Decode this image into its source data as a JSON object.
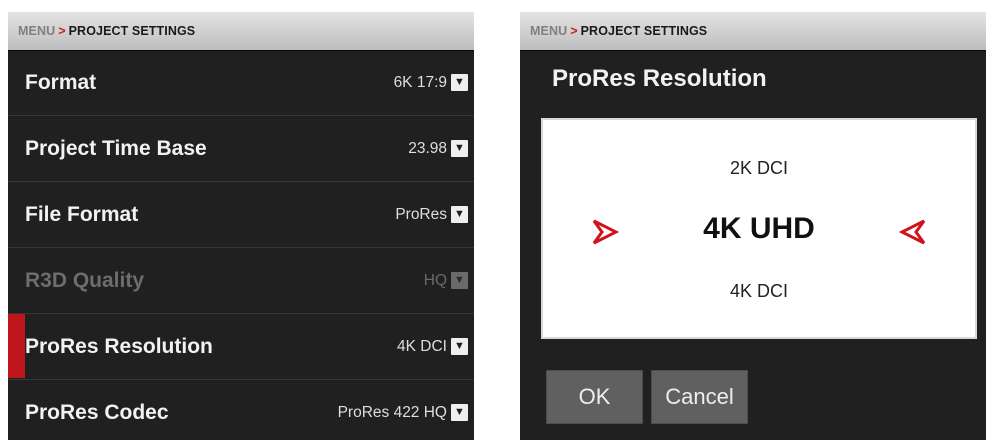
{
  "left": {
    "breadcrumb": {
      "menu": "MENU",
      "separator": ">",
      "page": "PROJECT SETTINGS"
    },
    "rows": [
      {
        "label": "Format",
        "value": "6K 17:9"
      },
      {
        "label": "Project Time Base",
        "value": "23.98"
      },
      {
        "label": "File Format",
        "value": "ProRes"
      },
      {
        "label": "R3D Quality",
        "value": "HQ",
        "disabled": true
      },
      {
        "label": "ProRes Resolution",
        "value": "4K DCI",
        "selected": true
      },
      {
        "label": "ProRes Codec",
        "value": "ProRes 422 HQ"
      }
    ]
  },
  "right": {
    "breadcrumb": {
      "menu": "MENU",
      "separator": ">",
      "page": "PROJECT SETTINGS"
    },
    "title": "ProRes Resolution",
    "picker": {
      "previous": "2K DCI",
      "current": "4K UHD",
      "next": "4K DCI"
    },
    "buttons": {
      "ok": "OK",
      "cancel": "Cancel"
    }
  },
  "icons": {
    "dropdown": "chevron-down-icon",
    "arrow_left": "arrow-left-icon",
    "arrow_right": "arrow-right-icon"
  },
  "colors": {
    "accent": "#c0151b",
    "background": "#202020",
    "menubar": "#d4d4d4"
  }
}
